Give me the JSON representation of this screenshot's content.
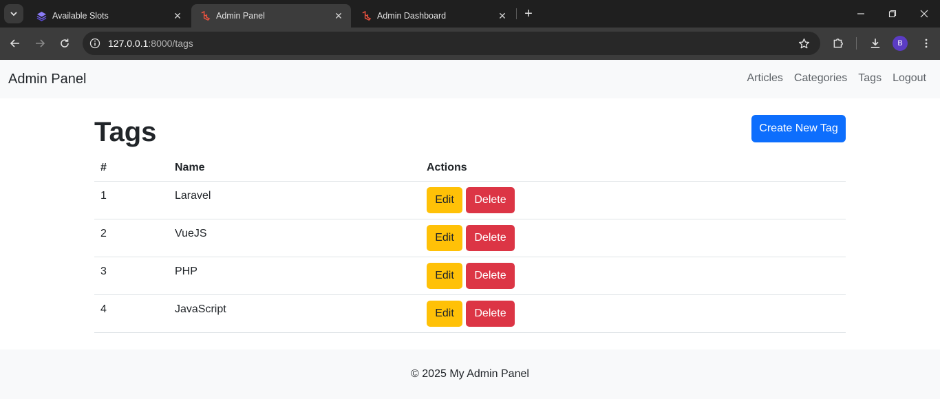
{
  "browser": {
    "tabs": [
      {
        "title": "Available Slots",
        "icon": "layers-icon",
        "active": false
      },
      {
        "title": "Admin Panel",
        "icon": "laravel-icon",
        "active": true
      },
      {
        "title": "Admin Dashboard",
        "icon": "laravel-icon",
        "active": false
      }
    ],
    "url_host": "127.0.0.1",
    "url_path": ":8000/tags",
    "profile_initial": "B"
  },
  "navbar": {
    "brand": "Admin Panel",
    "links": [
      "Articles",
      "Categories",
      "Tags",
      "Logout"
    ]
  },
  "main": {
    "title": "Tags",
    "create_label": "Create New Tag",
    "columns": [
      "#",
      "Name",
      "Actions"
    ],
    "rows": [
      {
        "id": "1",
        "name": "Laravel"
      },
      {
        "id": "2",
        "name": "VueJS"
      },
      {
        "id": "3",
        "name": "PHP"
      },
      {
        "id": "4",
        "name": "JavaScript"
      }
    ],
    "edit_label": "Edit",
    "delete_label": "Delete"
  },
  "footer": {
    "text": "© 2025 My Admin Panel"
  },
  "colors": {
    "primary": "#0d6efd",
    "warning": "#ffc107",
    "danger": "#dc3545"
  }
}
